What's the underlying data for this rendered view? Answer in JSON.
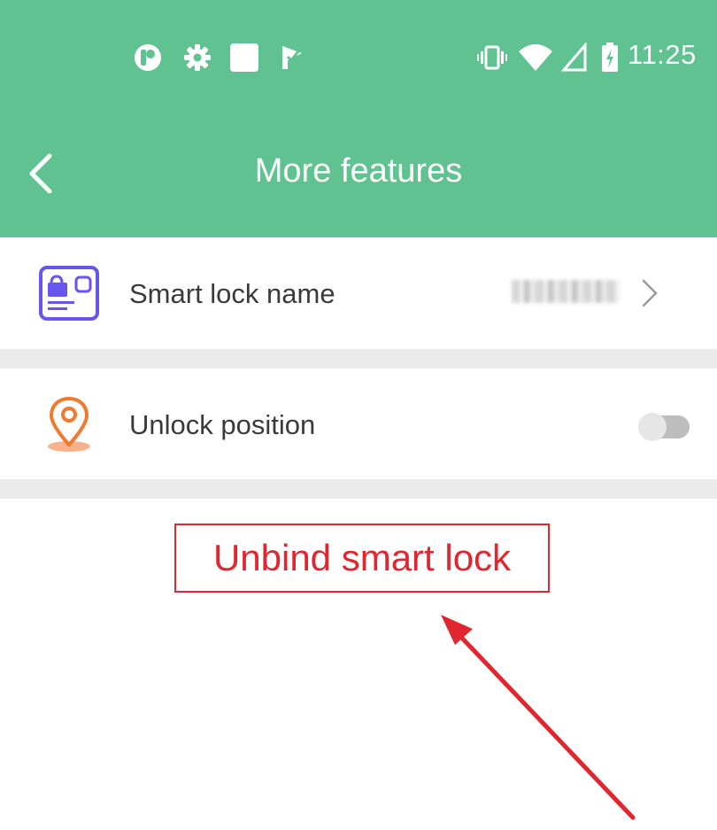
{
  "status_bar": {
    "time": "11:25",
    "left_icons": [
      "app-c-icon",
      "gear-icon",
      "square-icon",
      "check-flag-icon"
    ],
    "right_icons": [
      "vibrate-icon",
      "wifi-icon",
      "signal-icon",
      "battery-charging-icon"
    ]
  },
  "header": {
    "title": "More features",
    "back_icon": "chevron-left-icon",
    "background_color": "#5fc290"
  },
  "settings": {
    "lock_name": {
      "label": "Smart lock name",
      "icon": "lock-card-icon",
      "value_blurred": true,
      "chevron_icon": "chevron-right-icon"
    },
    "unlock_position": {
      "label": "Unlock position",
      "icon": "location-pin-icon",
      "toggle_on": false
    }
  },
  "actions": {
    "unbind_label": "Unbind smart lock",
    "accent_color": "#e0262f"
  },
  "annotation": {
    "arrow_color": "#e0262f"
  }
}
